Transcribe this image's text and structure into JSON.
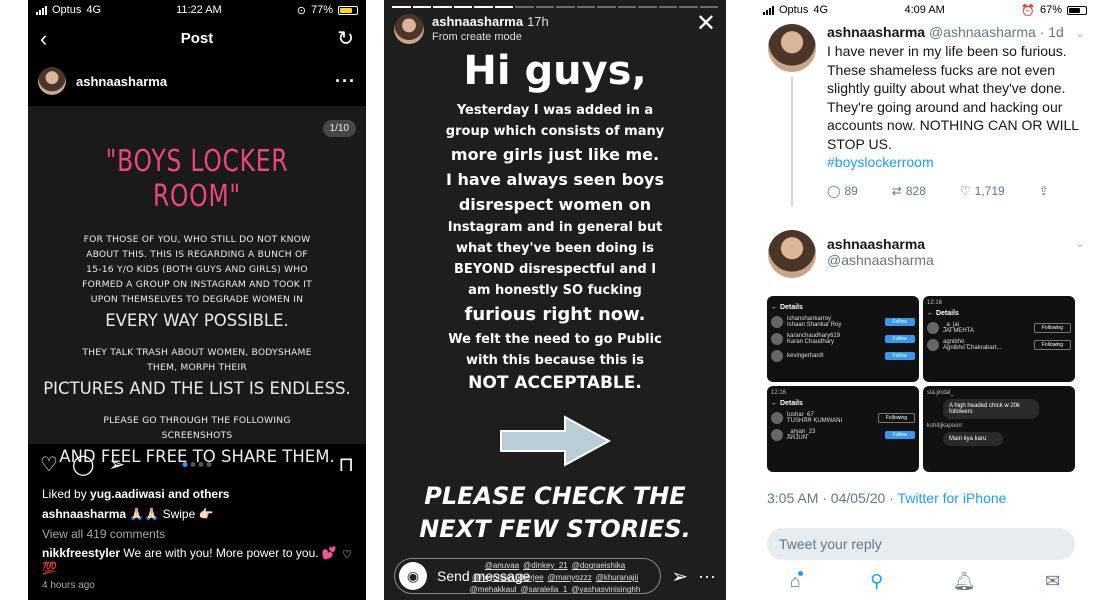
{
  "instagram_post": {
    "status_bar": {
      "carrier": "Optus",
      "network": "4G",
      "time": "11:22 AM",
      "battery": "77%",
      "battery_fill": 0.77
    },
    "nav": {
      "title": "Post",
      "back_icon": "chevron-left-icon",
      "refresh_icon": "refresh-icon"
    },
    "username": "ashnaasharma",
    "image": {
      "counter": "1/10",
      "title": "\"BOYS LOCKER ROOM\"",
      "para1": "FOR THOSE OF YOU, WHO STILL DO NOT KNOW ABOUT THIS. THIS IS REGARDING A BUNCH OF 15-16 Y/O KIDS (BOTH GUYS AND GIRLS) WHO FORMED A GROUP ON INSTAGRAM AND TOOK IT UPON THEMSELVES TO DEGRADE WOMEN IN",
      "big1": "EVERY WAY POSSIBLE.",
      "para2": "THEY TALK TRASH ABOUT WOMEN, BODYSHAME THEM, MORPH THEIR",
      "big2": "PICTURES AND THE LIST IS ENDLESS.",
      "para3": "PLEASE GO THROUGH THE FOLLOWING SCREENSHOTS",
      "big3": "AND FEEL FREE TO SHARE THEM."
    },
    "liked_by_prefix": "Liked by ",
    "liked_by_user": "yug.aadiwasi",
    "liked_by_suffix": " and others",
    "caption_user": "ashnaasharma",
    "caption_text": " 🙏🏻🙏🏻 Swipe 👉🏻",
    "view_comments": "View all 419 comments",
    "comment_user": "nikkfreestyler",
    "comment_text": " We are with you! More power to you. 💕💯",
    "time_ago": "4 hours ago"
  },
  "instagram_story": {
    "username": "ashnaasharma",
    "age": "17h",
    "subtitle": "From create mode",
    "hi": "Hi guys,",
    "body_lines": [
      "Yesterday I was added in a",
      "group which consists of many",
      "more girls just like me.",
      "I have always seen boys",
      "disrespect women on",
      "Instagram and in general but",
      "what they've been doing is",
      "BEYOND disrespectful and I",
      "am honestly SO fucking",
      "furious right now.",
      "We felt the need to go Public",
      "with this because this is",
      "NOT ACCEPTABLE."
    ],
    "check_line1": "PLEASE CHECK THE",
    "check_line2": "NEXT FEW STORIES.",
    "tags_row1": [
      "@anuvaa",
      "@dinkey_21",
      "@dograeishika"
    ],
    "tags_row2": [
      "@noyonamukherjee",
      "@manyozzz",
      "@khuranajii"
    ],
    "tags_row3": [
      "@mehakkaul",
      "@saraleila_1",
      "@yashasvinisinghh"
    ],
    "message_placeholder": "Send message"
  },
  "twitter": {
    "status_bar": {
      "carrier": "Optus",
      "network": "4G",
      "time": "4:09 AM",
      "battery": "67%",
      "battery_fill": 0.67
    },
    "tweet1": {
      "name": "ashnaasharma",
      "handle": "@ashnaasharma",
      "age": "· 1d",
      "text": "I have never in my life been so furious. These shameless fucks are not even slightly guilty about what they've done. They're going around and hacking our accounts now. NOTHING CAN OR WILL STOP US.",
      "hashtag": "#boyslockerroom",
      "replies": "89",
      "retweets": "828",
      "likes": "1,719"
    },
    "tweet2": {
      "name": "ashnaasharma",
      "handle": "@ashnaasharma",
      "timestamp": "3:05 AM · 04/05/20 · ",
      "source": "Twitter for iPhone"
    },
    "shots": {
      "s1": {
        "title": "Details",
        "rows": [
          {
            "name": "ishanshankarroy",
            "sub": "Ishaan Shankar Roy",
            "btn": "Follow"
          },
          {
            "name": "karanchaudhary619",
            "sub": "Karan Chaudhary",
            "btn": "Follow"
          },
          {
            "name": "kevingerhardt",
            "sub": "",
            "btn": "Follow"
          }
        ]
      },
      "s2": {
        "time": "12:16",
        "title": "Details",
        "rows": [
          {
            "name": "_a_jai",
            "sub": "JAI MEHTA",
            "btn": "Following"
          },
          {
            "name": "agnibho_",
            "sub": "Agnibho Chakrabart...",
            "btn": "Following"
          }
        ]
      },
      "s3": {
        "time": "12:16",
        "title": "Details",
        "rows": [
          {
            "name": "tushar_67",
            "sub": "TUSHAR KUMWANI",
            "btn": "Following"
          },
          {
            "name": "_aryan_23",
            "sub": "ARJUN",
            "btn": "Follow"
          }
        ]
      },
      "s4": {
        "user1": "sia.jindal_",
        "msg1": "A high headed chick w 20k followers",
        "user2": "kshitijkapoorr",
        "msg2": "Main kya karu"
      }
    },
    "reply_placeholder": "Tweet your reply"
  }
}
